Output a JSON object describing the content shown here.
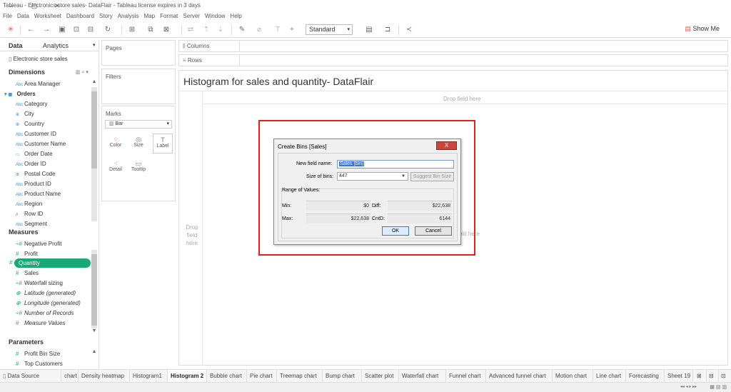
{
  "window": {
    "title": "Tableau - Electronics store sales- DataFlair - Tableau license expires in 3 days",
    "controls": [
      "–",
      "▢",
      "✕"
    ]
  },
  "menu": [
    "File",
    "Data",
    "Worksheet",
    "Dashboard",
    "Story",
    "Analysis",
    "Map",
    "Format",
    "Server",
    "Window",
    "Help"
  ],
  "toolbar": {
    "fit_select": "Standard",
    "show_me": "Show Me"
  },
  "left_panel": {
    "tabs": [
      "Data",
      "Analytics"
    ],
    "datasource": "Electronic store sales",
    "dimensions_header": "Dimensions",
    "dimensions": [
      {
        "label": "Area Manager",
        "icon": "Abc"
      },
      {
        "label": "Orders",
        "icon": "▦",
        "group": true
      },
      {
        "label": "Category",
        "icon": "Abc"
      },
      {
        "label": "City",
        "icon": "⊕"
      },
      {
        "label": "Country",
        "icon": "⊕"
      },
      {
        "label": "Customer ID",
        "icon": "Abc"
      },
      {
        "label": "Customer Name",
        "icon": "Abc"
      },
      {
        "label": "Order Date",
        "icon": "▭"
      },
      {
        "label": "Order ID",
        "icon": "Abc"
      },
      {
        "label": "Postal Code",
        "icon": "⊕"
      },
      {
        "label": "Product ID",
        "icon": "Abc"
      },
      {
        "label": "Product Name",
        "icon": "Abc"
      },
      {
        "label": "Region",
        "icon": "Abc"
      },
      {
        "label": "Row ID",
        "icon": "#"
      },
      {
        "label": "Segment",
        "icon": "Abc"
      }
    ],
    "measures_header": "Measures",
    "measures": [
      {
        "label": "Negative Profit",
        "icon": "÷#",
        "italic": false
      },
      {
        "label": "Profit",
        "icon": "#",
        "italic": false
      },
      {
        "label": "Quantity",
        "icon": "#",
        "italic": false,
        "selected": true
      },
      {
        "label": "Sales",
        "icon": "#",
        "italic": false
      },
      {
        "label": "Waterfall sizing",
        "icon": "÷#",
        "italic": false
      },
      {
        "label": "Latitude (generated)",
        "icon": "⊕",
        "italic": true
      },
      {
        "label": "Longitude (generated)",
        "icon": "⊕",
        "italic": true
      },
      {
        "label": "Number of Records",
        "icon": "÷#",
        "italic": true
      },
      {
        "label": "Measure Values",
        "icon": "#",
        "italic": true
      }
    ],
    "parameters_header": "Parameters",
    "parameters": [
      {
        "label": "Profit Bin Size",
        "icon": "#"
      },
      {
        "label": "Top Customers",
        "icon": "#"
      }
    ]
  },
  "cards": {
    "pages": "Pages",
    "filters": "Filters",
    "marks": "Marks",
    "mark_type": "Bar",
    "mark_buttons": [
      "Color",
      "Size",
      "Label",
      "Detail",
      "Tooltip"
    ]
  },
  "shelves": {
    "columns": "Columns",
    "rows": "Rows"
  },
  "view": {
    "title": "Histogram for sales and quantity- DataFlair",
    "drop_top": "Drop field here",
    "drop_left": "Drop field here",
    "drop_center": "eld here"
  },
  "dialog": {
    "title": "Create Bins [Sales]",
    "close": "X",
    "new_field_label": "New field name:",
    "new_field_value": "Sales (bin)",
    "size_label": "Size of bins:",
    "size_value": "447",
    "suggest_button": "Suggest Bin Size",
    "range_label": "Range of Values:",
    "min_label": "Min:",
    "min_value": "$0",
    "diff_label": "Diff:",
    "diff_value": "$22,638",
    "max_label": "Max:",
    "max_value": "$22,638",
    "cntd_label": "CntD:",
    "cntd_value": "6144",
    "ok": "OK",
    "cancel": "Cancel"
  },
  "sheet_tabs": {
    "datasource": "Data Source",
    "tabs": [
      "chart",
      "Density heatmap",
      "Histogram1",
      "Histogram 2",
      "Bubble chart",
      "Pie chart",
      "Treemap chart",
      "Bump chart",
      "Scatter plot",
      "Waterfall chart",
      "Funnel chart",
      "Advanced funnel chart",
      "Motion chart",
      "Line chart",
      "Forecasting",
      "Sheet 19"
    ],
    "active": "Histogram 2"
  },
  "colors": {
    "accent_green": "#19a974",
    "highlight_red": "#e02020",
    "dialog_close_red": "#c9463d"
  }
}
